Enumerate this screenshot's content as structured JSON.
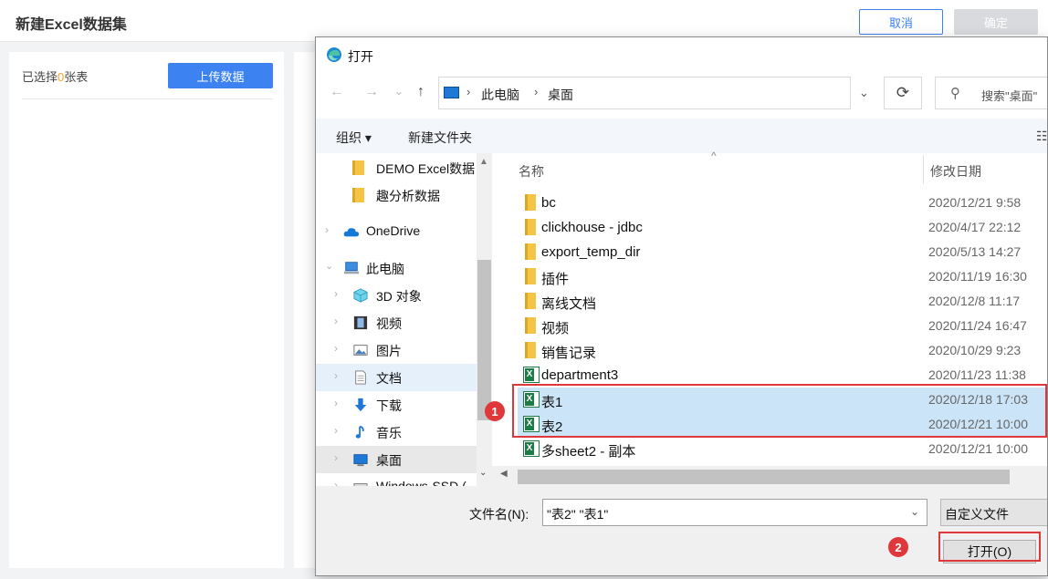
{
  "app": {
    "title": "新建Excel数据集",
    "cancel_label": "取消",
    "confirm_label": "确定",
    "selected_prefix": "已选择",
    "selected_count": "0",
    "selected_suffix": "张表",
    "upload_label": "上传数据"
  },
  "dialog": {
    "title": "打开",
    "nav_back": "←",
    "nav_forward": "→",
    "nav_recent": "⌄",
    "nav_up": "↑",
    "address": {
      "sep1": "›",
      "crumb1": "此电脑",
      "sep2": "›",
      "crumb2": "桌面",
      "dropdown": "⌄"
    },
    "refresh": "⟳",
    "search_placeholder": "搜索\"桌面\"",
    "toolbar": {
      "organize": "组织 ▾",
      "new_folder": "新建文件夹",
      "view": "☷"
    },
    "nav_items": [
      {
        "label": "DEMO Excel数据",
        "icon": "folder-icon"
      },
      {
        "label": "趣分析数据",
        "icon": "folder-icon"
      },
      {
        "label": "OneDrive",
        "icon": "cloud-icon"
      },
      {
        "label": "此电脑",
        "icon": "computer-icon"
      },
      {
        "label": "3D 对象",
        "icon": "cube-icon"
      },
      {
        "label": "视频",
        "icon": "film-icon"
      },
      {
        "label": "图片",
        "icon": "picture-icon"
      },
      {
        "label": "文档",
        "icon": "document-icon"
      },
      {
        "label": "下载",
        "icon": "download-icon"
      },
      {
        "label": "音乐",
        "icon": "music-icon"
      },
      {
        "label": "桌面",
        "icon": "desktop-icon"
      },
      {
        "label": "Windows-SSD (",
        "icon": "drive-icon"
      }
    ],
    "columns": {
      "name": "名称",
      "sort": "^",
      "date": "修改日期"
    },
    "files": [
      {
        "name": "bc",
        "date": "2020/12/21 9:58",
        "type": "folder"
      },
      {
        "name": "clickhouse - jdbc",
        "date": "2020/4/17 22:12",
        "type": "folder"
      },
      {
        "name": "export_temp_dir",
        "date": "2020/5/13 14:27",
        "type": "folder"
      },
      {
        "name": "插件",
        "date": "2020/11/19 16:30",
        "type": "folder"
      },
      {
        "name": "离线文档",
        "date": "2020/12/8 11:17",
        "type": "folder"
      },
      {
        "name": "视频",
        "date": "2020/11/24 16:47",
        "type": "folder"
      },
      {
        "name": "销售记录",
        "date": "2020/10/29 9:23",
        "type": "folder"
      },
      {
        "name": "department3",
        "date": "2020/11/23 11:38",
        "type": "excel"
      },
      {
        "name": "表1",
        "date": "2020/12/18 17:03",
        "type": "excel",
        "selected": true
      },
      {
        "name": "表2",
        "date": "2020/12/21 10:00",
        "type": "excel",
        "selected": true
      },
      {
        "name": "多sheet2 - 副本",
        "date": "2020/12/21 10:00",
        "type": "excel"
      }
    ],
    "filename_label": "文件名(N):",
    "filename_value": "\"表2\" \"表1\"",
    "filename_dropdown": "⌄",
    "filter_label": "自定义文件",
    "open_label": "打开(O)"
  },
  "annotations": {
    "step1": "1",
    "step2": "2"
  },
  "colors": {
    "accent": "#3c82f0",
    "highlight": "#e0373a",
    "selection": "#cce4f7",
    "count": "#f5a623"
  }
}
